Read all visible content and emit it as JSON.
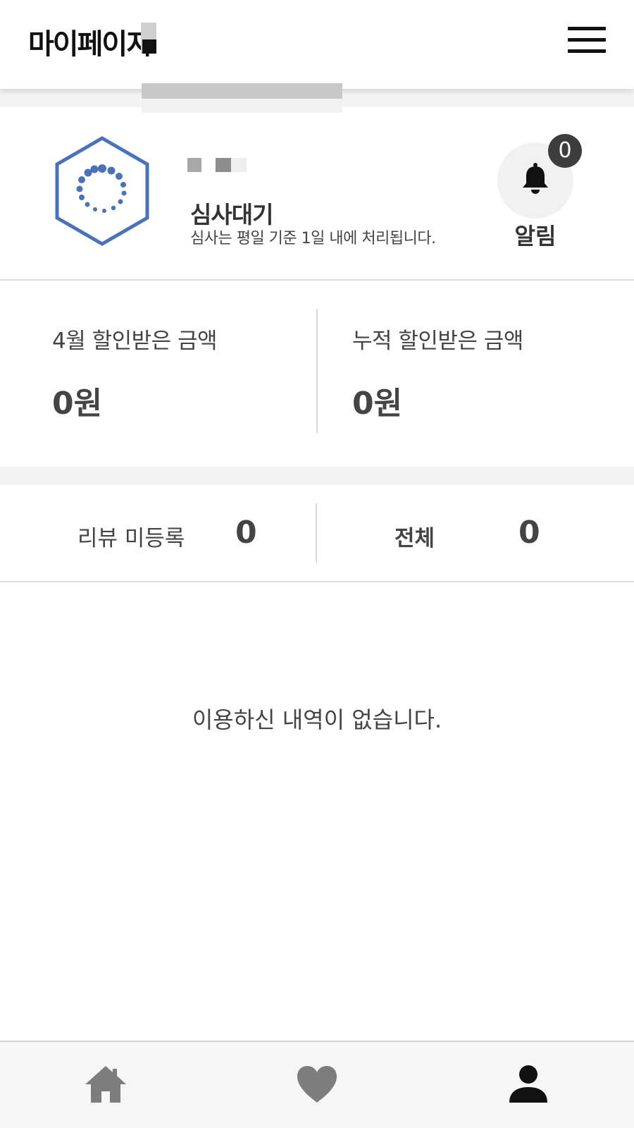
{
  "header": {
    "title": "마이페이지"
  },
  "profile": {
    "status_title": "심사대기",
    "status_desc": "심사는 평일 기준 1일 내에 처리됩니다.",
    "alarm": {
      "count": "0",
      "label": "알림"
    }
  },
  "stats": [
    {
      "label": "4월 할인받은 금액",
      "value": "0원"
    },
    {
      "label": "누적 할인받은 금액",
      "value": "0원"
    }
  ],
  "reviews": {
    "tabs": [
      {
        "label": "리뷰 미등록",
        "count": "0"
      },
      {
        "label": "전체",
        "count": "0"
      }
    ]
  },
  "empty_message": "이용하신 내역이 없습니다.",
  "bottom_nav": [
    {
      "icon": "home-icon",
      "active": false
    },
    {
      "icon": "heart-icon",
      "active": false
    },
    {
      "icon": "user-icon",
      "active": true
    }
  ],
  "colors": {
    "hex_icon": "#4a72b8",
    "text_dark": "#333333",
    "nav_inactive": "#7d7d7d",
    "nav_active": "#111111"
  }
}
